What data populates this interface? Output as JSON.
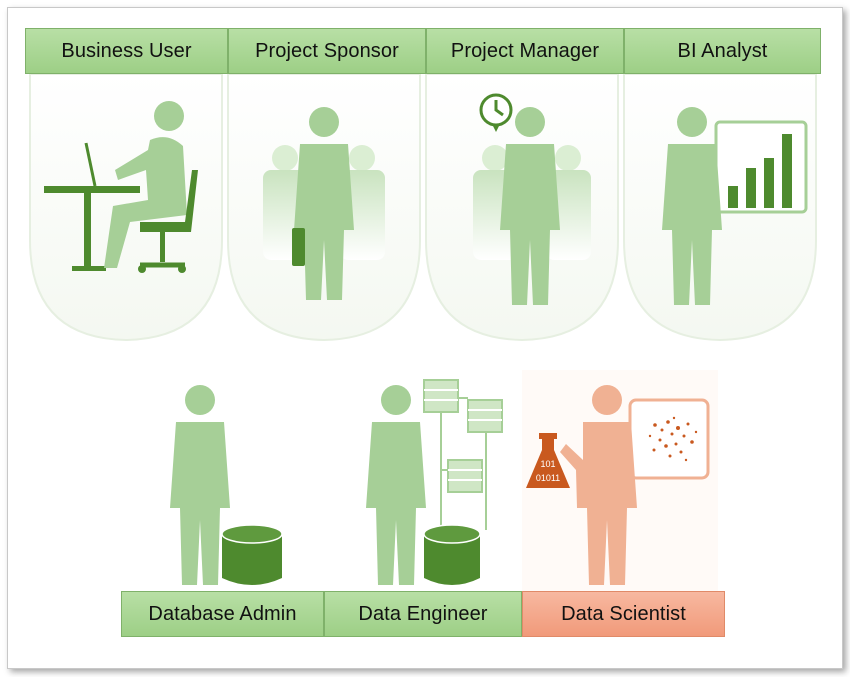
{
  "roles": {
    "top": [
      {
        "id": "business-user",
        "label": "Business User"
      },
      {
        "id": "project-sponsor",
        "label": "Project Sponsor"
      },
      {
        "id": "project-manager",
        "label": "Project Manager"
      },
      {
        "id": "bi-analyst",
        "label": "BI Analyst"
      }
    ],
    "bottom": [
      {
        "id": "database-admin",
        "label": "Database Admin"
      },
      {
        "id": "data-engineer",
        "label": "Data Engineer"
      },
      {
        "id": "data-scientist",
        "label": "Data Scientist"
      }
    ]
  },
  "flask_text": {
    "line1": "101",
    "line2": "01011"
  },
  "colors": {
    "label_green": "#a9d694",
    "label_salmon": "#f4a88a",
    "figure_green": "#a6cf97",
    "accent_green": "#4e8a2e",
    "figure_salmon": "#f0b193",
    "accent_orange": "#c9591f"
  }
}
